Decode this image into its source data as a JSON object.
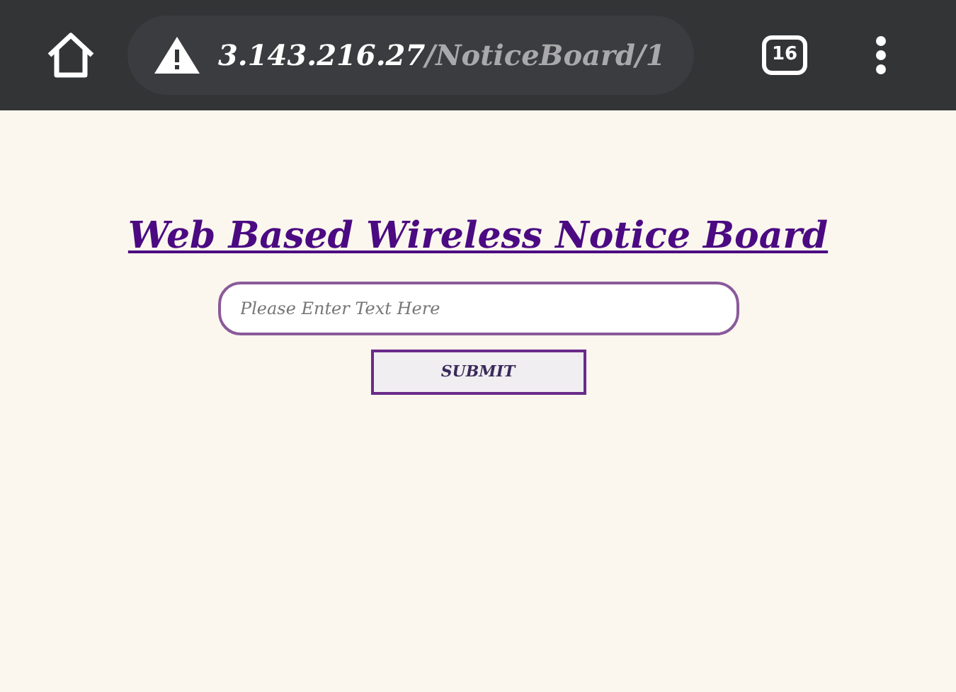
{
  "browser": {
    "url_host": "3.143.216.27",
    "url_path": "/NoticeBoard/1",
    "tab_count": "16"
  },
  "page": {
    "title": "Web Based Wireless Notice Board",
    "input": {
      "placeholder": "Please Enter Text Here"
    },
    "submit": "SUBMIT"
  }
}
